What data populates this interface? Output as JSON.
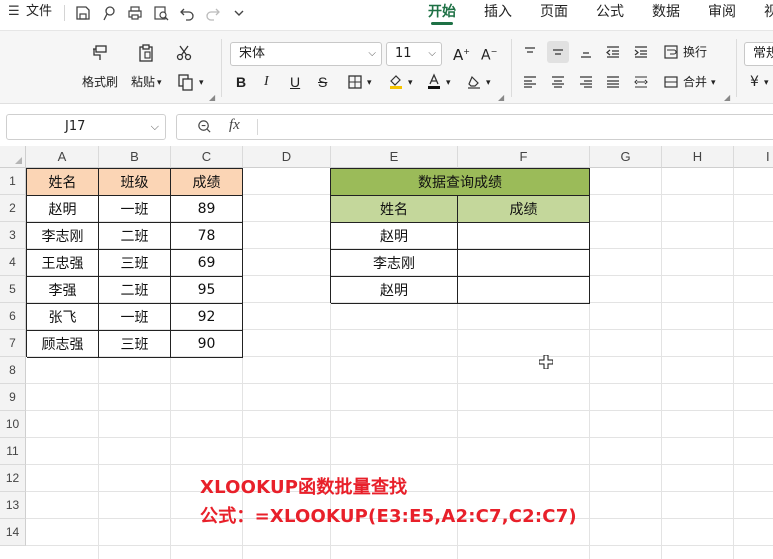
{
  "menu": {
    "hamburger": "☰",
    "file": "文件",
    "tabs": [
      "开始",
      "插入",
      "页面",
      "公式",
      "数据",
      "审阅",
      "视"
    ]
  },
  "ribbon": {
    "format_painter": "格式刷",
    "paste": "粘贴",
    "font_name": "宋体",
    "font_size": "11",
    "wrap_text": "换行",
    "merge": "合并",
    "number_format": "常规",
    "currency_symbol": "¥"
  },
  "formula_bar": {
    "name_box": "J17",
    "fx": "fx",
    "formula": ""
  },
  "sheet": {
    "columns": [
      "A",
      "B",
      "C",
      "D",
      "E",
      "F",
      "G",
      "H",
      "I"
    ],
    "rows": [
      "1",
      "2",
      "3",
      "4",
      "5",
      "6",
      "7",
      "8",
      "9",
      "10",
      "11",
      "12",
      "13",
      "14"
    ],
    "source_table": {
      "headers": [
        "姓名",
        "班级",
        "成绩"
      ],
      "rows": [
        [
          "赵明",
          "一班",
          "89"
        ],
        [
          "李志刚",
          "二班",
          "78"
        ],
        [
          "王忠强",
          "三班",
          "69"
        ],
        [
          "李强",
          "二班",
          "95"
        ],
        [
          "张飞",
          "一班",
          "92"
        ],
        [
          "顾志强",
          "三班",
          "90"
        ]
      ]
    },
    "lookup_table": {
      "title": "数据查询成绩",
      "headers": [
        "姓名",
        "成绩"
      ],
      "rows": [
        [
          "赵明",
          ""
        ],
        [
          "李志刚",
          ""
        ],
        [
          "赵明",
          ""
        ]
      ]
    }
  },
  "caption": {
    "line1": "XLOOKUP函数批量查找",
    "line2": "公式：=XLOOKUP(E3:E5,A2:C7,C2:C7)"
  },
  "colors": {
    "accent": "#1e7145",
    "peach_header": "#fbd5b5",
    "green_title": "#9bbb59",
    "light_green_header": "#c4d79b",
    "caption_red": "#e8202a"
  }
}
